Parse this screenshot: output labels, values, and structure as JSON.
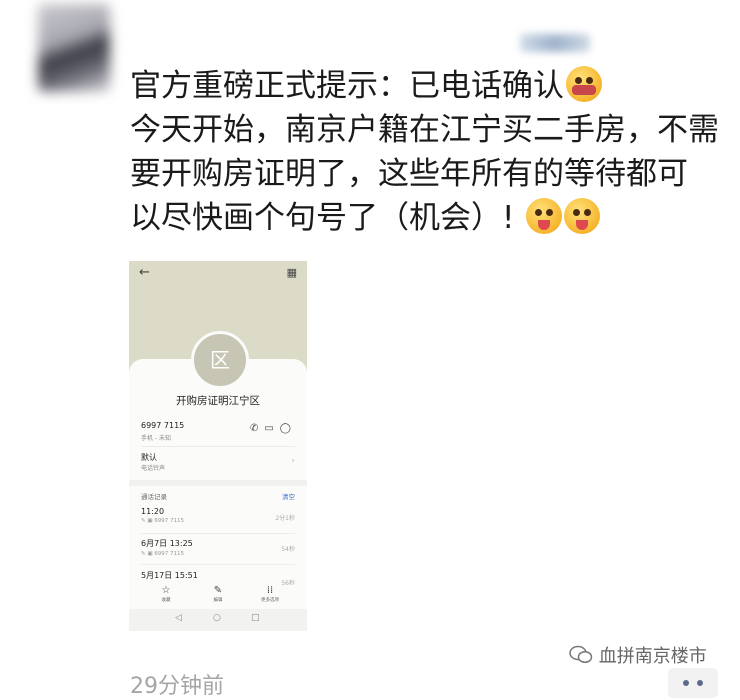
{
  "post": {
    "lines": [
      "官方重磅正式提示：已电话确认",
      "今天开始，南京户籍在江宁买二手房，不需",
      "要开购房证明了，这些年所有的等待都可",
      "以尽快画个句号了（机会）!"
    ]
  },
  "phone": {
    "avatar_char": "区",
    "contact_name": "开购房证明江宁区",
    "number": "6997 7115",
    "number_sub": "手机 - 未知",
    "default_label": "默认",
    "default_sub": "电话铃声",
    "calls_title": "通话记录",
    "clear_label": "清空",
    "calls": [
      {
        "time": "11:20",
        "sub": "6997 7115",
        "duration": "2分1秒"
      },
      {
        "time": "6月7日 13:25",
        "sub": "6997 7115",
        "duration": "54秒"
      },
      {
        "time": "5月17日 15:51",
        "sub": "",
        "duration": "56秒"
      }
    ],
    "tabs": [
      "收藏",
      "编辑",
      "更多选项"
    ]
  },
  "watermark": "血拼南京楼市",
  "timestamp": "29分钟前"
}
